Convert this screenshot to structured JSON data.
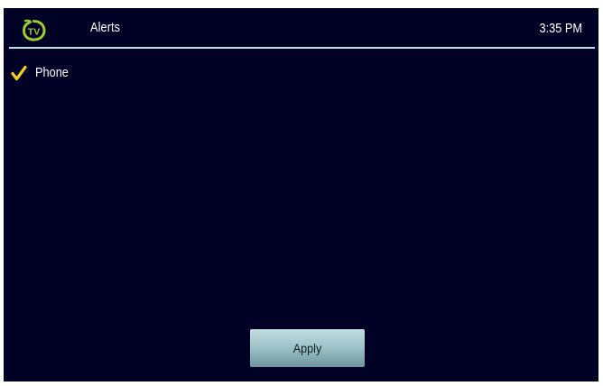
{
  "header": {
    "logo_text": "TV",
    "title": "Alerts",
    "time": "3:35 PM"
  },
  "options": [
    {
      "label": "Phone",
      "checked": true,
      "icon": "checkmark-icon"
    }
  ],
  "footer": {
    "apply_label": "Apply"
  },
  "colors": {
    "background": "#010025",
    "accent_green": "#9acd32",
    "check_yellow": "#f2cf1a",
    "rule": "#bfe4ea"
  }
}
